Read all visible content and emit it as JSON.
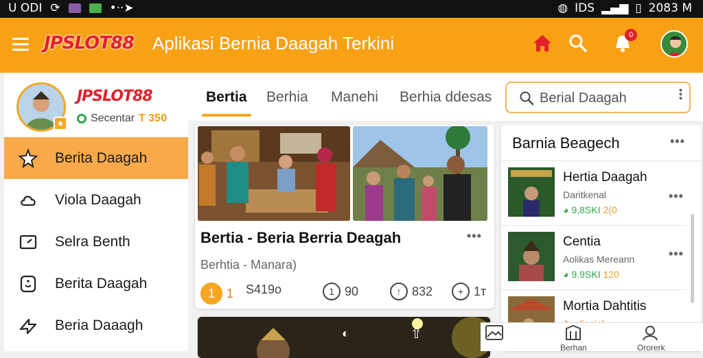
{
  "status_bar": {
    "left_text": "U ODI",
    "time": "2083 M",
    "signal_label": "IDS"
  },
  "app_bar": {
    "logo": "JPSLOT88",
    "title": "Aplikasi Bernia Daagah Terkini",
    "notification_count": "0"
  },
  "sidebar": {
    "logo": "JPSLOT88",
    "subtitle": "Secentar",
    "subtitle_badge": "T 350",
    "items": [
      {
        "label": "Berita Daagah",
        "icon": "star-icon",
        "active": true
      },
      {
        "label": "Viola Daagah",
        "icon": "cloud-icon",
        "active": false
      },
      {
        "label": "Selra Benth",
        "icon": "tablet-icon",
        "active": false
      },
      {
        "label": "Berita Daagah",
        "icon": "smiley-icon",
        "active": false
      },
      {
        "label": "Beria Daaagh",
        "icon": "arrow-icon",
        "active": false
      }
    ]
  },
  "tabs": [
    {
      "label": "Bertia",
      "active": true
    },
    {
      "label": "Berhia",
      "active": false
    },
    {
      "label": "Manehi",
      "active": false
    },
    {
      "label": "Berhia ddesas",
      "active": false
    }
  ],
  "search": {
    "placeholder": "Berial Daagah"
  },
  "feed_card": {
    "title": "Bertia - Beria Berria Deagah",
    "subtitle": "Berhtia - Manara)",
    "stats": [
      {
        "icon": "1",
        "value": "1"
      },
      {
        "icon": "",
        "value": "S419o"
      },
      {
        "icon": "1",
        "value": "90"
      },
      {
        "icon": "↑",
        "value": "832"
      },
      {
        "icon": "+",
        "value": "1т"
      }
    ]
  },
  "right_panel": {
    "heading": "Barnia Beagech",
    "items": [
      {
        "title": "Hertia Daagah",
        "subtitle": "Daritkenal",
        "meta": [
          "9,8SKI",
          "2(0"
        ]
      },
      {
        "title": "Centia",
        "subtitle": "Aolikas Mereann",
        "meta": [
          "9.9SKI",
          "120"
        ]
      },
      {
        "title": "Mortia Dahtitis",
        "subtitle": "Apeliacial",
        "meta": []
      }
    ]
  },
  "bottom_nav": {
    "items": [
      "Berhan",
      "Ororerk"
    ]
  },
  "colors": {
    "accent": "#f8a114",
    "active_nav": "#f8a94a",
    "logo_red": "#e3202a",
    "stat_green": "#2ba84a"
  }
}
